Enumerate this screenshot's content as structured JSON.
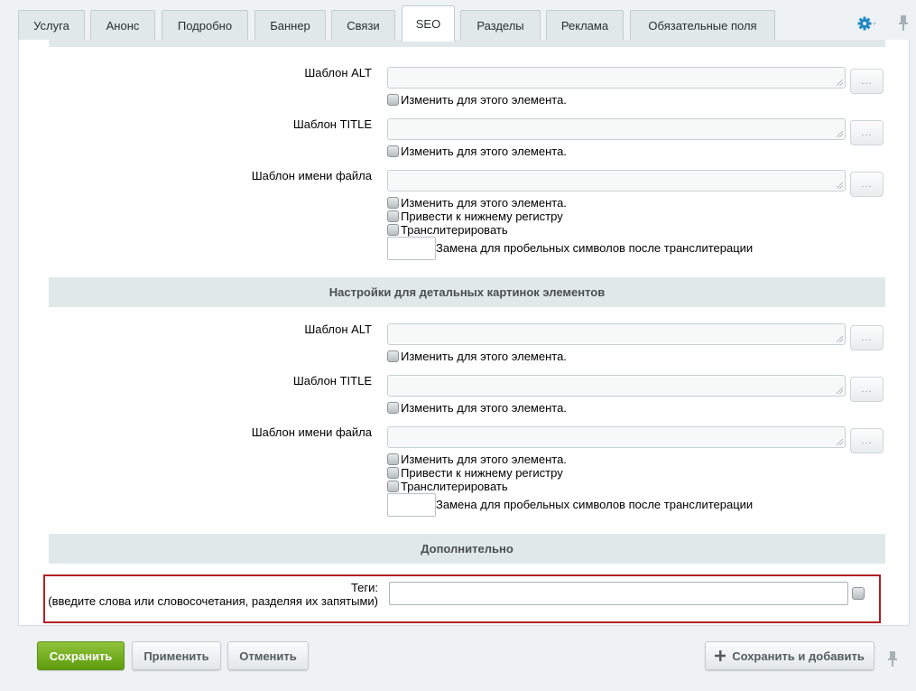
{
  "tabs": [
    {
      "label": "Услуга",
      "active": false
    },
    {
      "label": "Анонс",
      "active": false
    },
    {
      "label": "Подробно",
      "active": false
    },
    {
      "label": "Баннер",
      "active": false
    },
    {
      "label": "Связи",
      "active": false
    },
    {
      "label": "SEO",
      "active": true
    },
    {
      "label": "Разделы",
      "active": false
    },
    {
      "label": "Реклама",
      "active": false
    },
    {
      "label": "Обязательные поля",
      "active": false
    }
  ],
  "preview_images": {
    "alt_label": "Шаблон ALT",
    "title_label": "Шаблон TITLE",
    "filename_label": "Шаблон имени файла",
    "change_for_element": "Изменить для этого элемента.",
    "lowercase": "Привести к нижнему регистру",
    "transliterate": "Транслитерировать",
    "space_replacement": "Замена для пробельных символов после транслитерации",
    "dots_label": "..."
  },
  "detail_images": {
    "section_title": "Настройки для детальных картинок элементов",
    "alt_label": "Шаблон ALT",
    "title_label": "Шаблон TITLE",
    "filename_label": "Шаблон имени файла",
    "change_for_element": "Изменить для этого элемента.",
    "lowercase": "Привести к нижнему регистру",
    "transliterate": "Транслитерировать",
    "space_replacement": "Замена для пробельных символов после транслитерации",
    "dots_label": "..."
  },
  "additional": {
    "section_title": "Дополнительно",
    "tags_label_line1": "Теги:",
    "tags_label_line2": "(введите слова или словосочетания, разделяя их запятыми)",
    "tags_value": ""
  },
  "footer": {
    "save": "Сохранить",
    "apply": "Применить",
    "cancel": "Отменить",
    "save_and_add": "Сохранить и добавить"
  },
  "colors": {
    "accent_green": "#6aa716",
    "highlight_red": "#b21e24",
    "gear_blue": "#1e88c7"
  }
}
